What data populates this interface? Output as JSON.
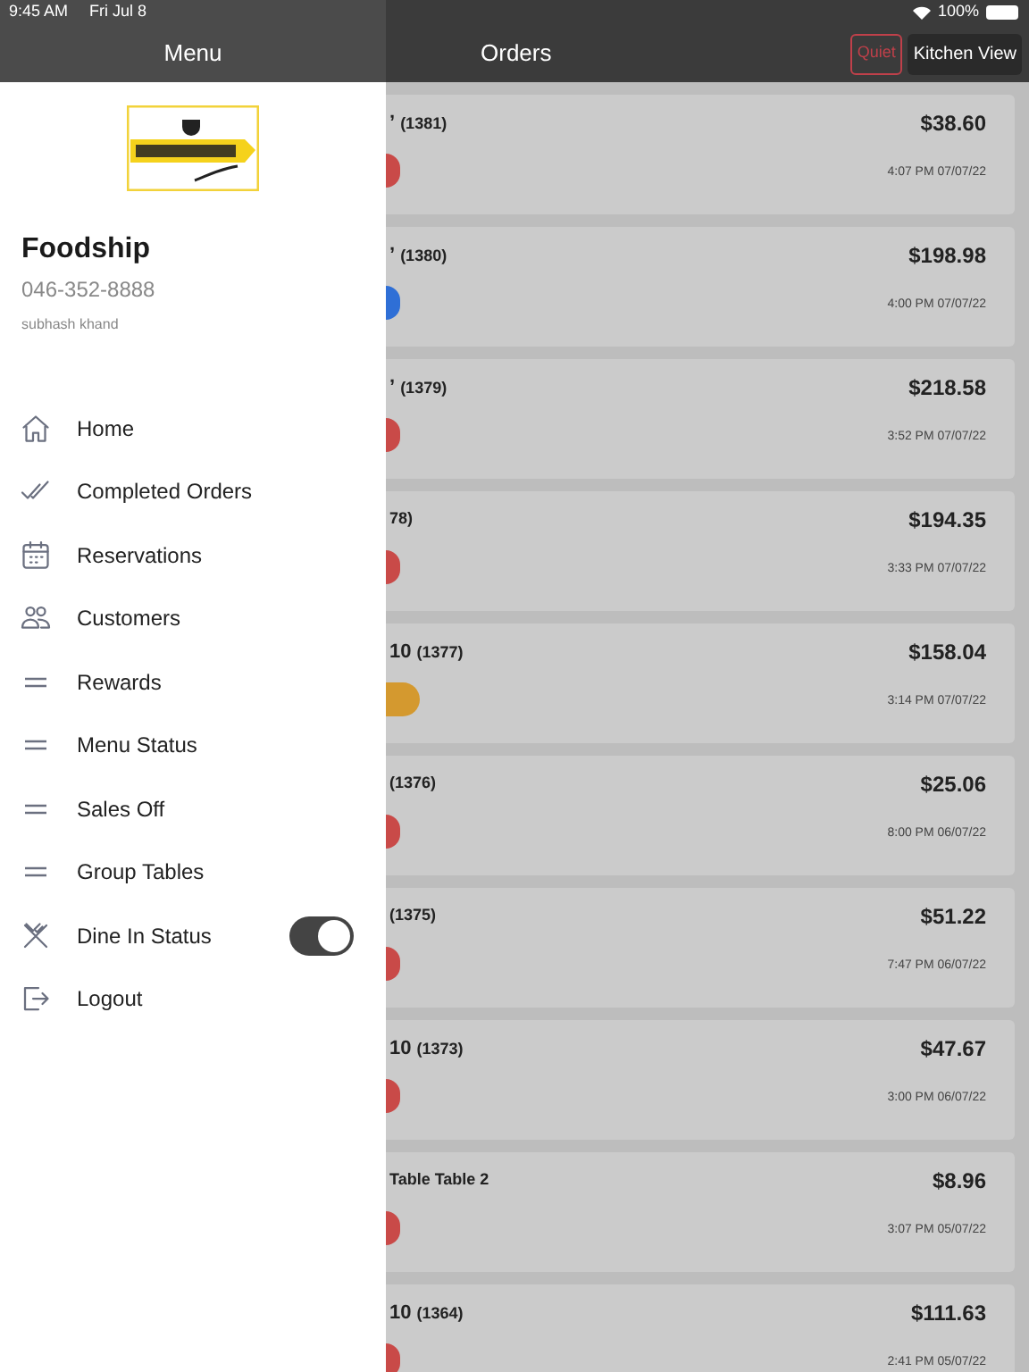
{
  "status_bar": {
    "time": "9:45 AM",
    "date": "Fri Jul 8",
    "battery": "100%"
  },
  "drawer": {
    "title": "Menu",
    "business_name": "Foodship",
    "phone": "046-352-8888",
    "user": "subhash khand",
    "items": [
      {
        "kind": "home",
        "label": "Home"
      },
      {
        "kind": "check",
        "label": "Completed Orders"
      },
      {
        "kind": "calendar",
        "label": "Reservations"
      },
      {
        "kind": "people",
        "label": "Customers"
      },
      {
        "kind": "lines",
        "label": "Rewards"
      },
      {
        "kind": "lines",
        "label": "Menu Status"
      },
      {
        "kind": "lines",
        "label": "Sales Off"
      },
      {
        "kind": "lines",
        "label": "Group Tables"
      },
      {
        "kind": "cutlery",
        "label": "Dine In Status",
        "on": true
      },
      {
        "kind": "logout",
        "label": "Logout"
      }
    ]
  },
  "header": {
    "title": "Orders",
    "quiet_button": "Quiet",
    "kitchen_button": "Kitchen View"
  },
  "orders": [
    {
      "table": "’",
      "number": "(1381)",
      "amount": "$38.60",
      "time": "4:07 PM 07/07/22",
      "color": "#c94a48",
      "wide": false
    },
    {
      "table": "’",
      "number": "(1380)",
      "amount": "$198.98",
      "time": "4:00 PM 07/07/22",
      "color": "#2f6fd6",
      "wide": false
    },
    {
      "table": "’",
      "number": "(1379)",
      "amount": "$218.58",
      "time": "3:52 PM 07/07/22",
      "color": "#c94a48",
      "wide": false
    },
    {
      "number": "78)",
      "amount": "$194.35",
      "time": "3:33 PM 07/07/22",
      "color": "#c94a48",
      "wide": false
    },
    {
      "table": "10",
      "number": "(1377)",
      "amount": "$158.04",
      "time": "3:14 PM 07/07/22",
      "color": "#d4992f",
      "wide": true
    },
    {
      "number": "(1376)",
      "amount": "$25.06",
      "time": "8:00 PM 06/07/22",
      "color": "#c94a48",
      "wide": false
    },
    {
      "number": "(1375)",
      "amount": "$51.22",
      "time": "7:47 PM 06/07/22",
      "color": "#c94a48",
      "wide": false
    },
    {
      "table": "10",
      "number": "(1373)",
      "amount": "$47.67",
      "time": "3:00 PM 06/07/22",
      "color": "#c94a48",
      "wide": false
    },
    {
      "number": "Table Table 2",
      "amount": "$8.96",
      "time": "3:07 PM 05/07/22",
      "color": "#c94a48",
      "wide": false
    },
    {
      "table": "10",
      "number": "(1364)",
      "amount": "$111.63",
      "time": "2:41 PM 05/07/22",
      "color": "#c94a48",
      "wide": false
    }
  ]
}
